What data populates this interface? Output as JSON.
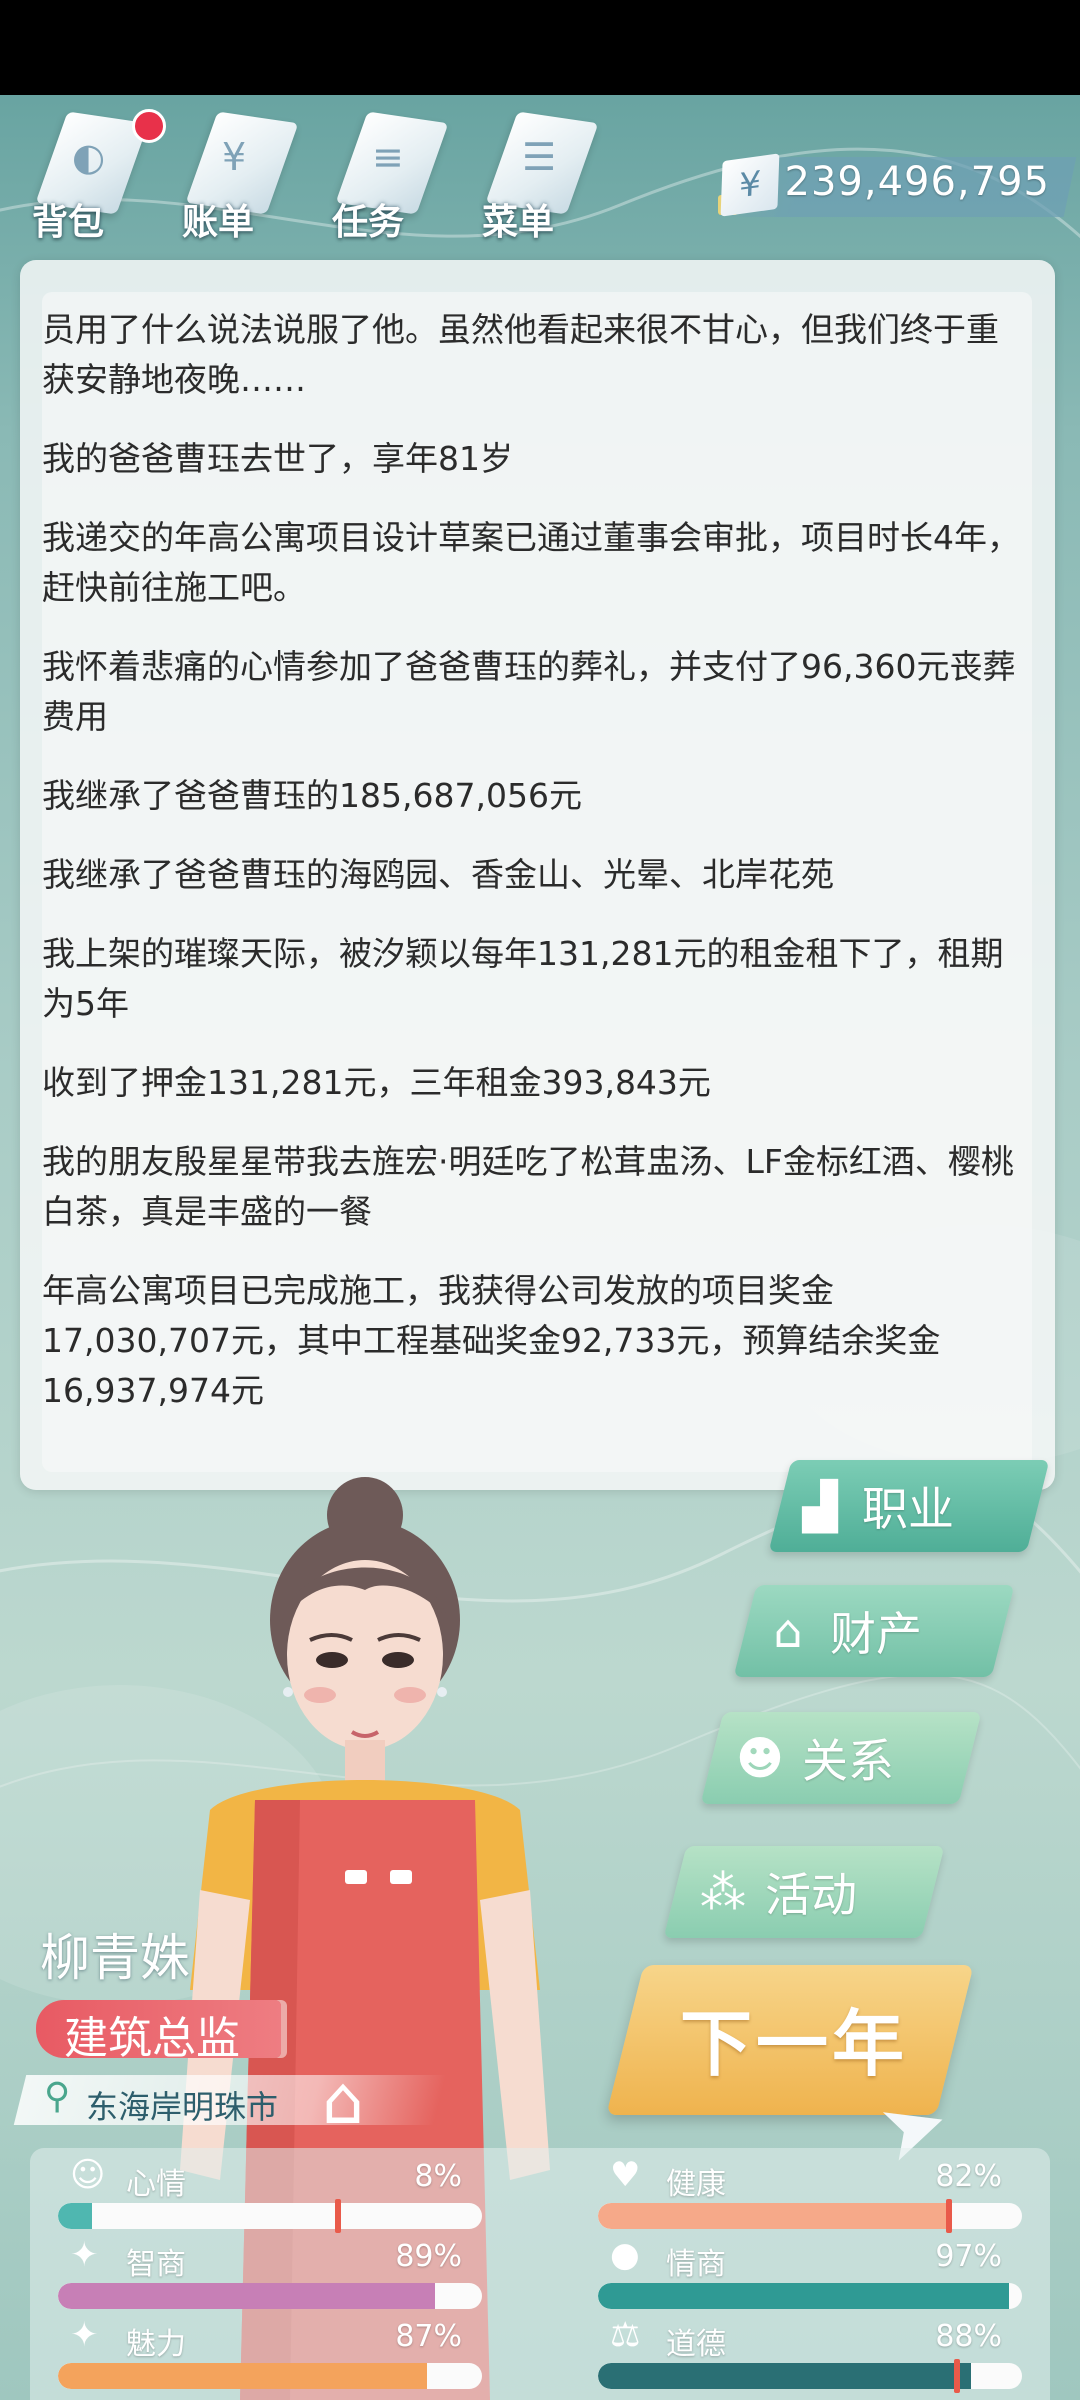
{
  "nav": {
    "items": [
      {
        "label": "背包",
        "icon": "backpack-icon",
        "badge": true
      },
      {
        "label": "账单",
        "icon": "bill-icon"
      },
      {
        "label": "任务",
        "icon": "task-icon"
      },
      {
        "label": "菜单",
        "icon": "menu-icon"
      }
    ],
    "money": {
      "currency_symbol": "¥",
      "value": "239,496,795"
    }
  },
  "log": [
    "员用了什么说法说服了他。虽然他看起来很不甘心，但我们终于重获安静地夜晚……",
    "我的爸爸曹珏去世了，享年81岁",
    "我递交的年高公寓项目设计草案已通过董事会审批，项目时长4年，赶快前往施工吧。",
    "我怀着悲痛的心情参加了爸爸曹珏的葬礼，并支付了96,360元丧葬费用",
    "我继承了爸爸曹珏的185,687,056元",
    "我继承了爸爸曹珏的海鸥园、香金山、光晕、北岸花苑",
    "我上架的璀璨天际，被汐颖以每年131,281元的租金租下了，租期为5年",
    "收到了押金131,281元，三年租金393,843元",
    "我的朋友殷星星带我去旌宏·明廷吃了松茸盅汤、LF金标红酒、樱桃白茶，真是丰盛的一餐",
    "年高公寓项目已完成施工，我获得公司发放的项目奖金17,030,707元，其中工程基础奖金92,733元，预算结余奖金16,937,974元"
  ],
  "actions": {
    "career": {
      "label": "职业",
      "icon": "chart-icon"
    },
    "assets": {
      "label": "财产",
      "icon": "house-icon"
    },
    "relations": {
      "label": "关系",
      "icon": "people-icon"
    },
    "activity": {
      "label": "活动",
      "icon": "dots-icon"
    },
    "next_year": {
      "label": "下一年"
    }
  },
  "character": {
    "name": "柳青姝",
    "job": "建筑总监",
    "city": "东海岸明珠市"
  },
  "stats": {
    "mood": {
      "label": "心情",
      "value": "8%",
      "level": 0.08,
      "color": "#4fb7b0"
    },
    "health": {
      "label": "健康",
      "value": "82%",
      "level": 0.82,
      "color": "#f6a989"
    },
    "iq": {
      "label": "智商",
      "value": "89%",
      "level": 0.89,
      "color": "#c77fb6"
    },
    "eq": {
      "label": "情商",
      "value": "97%",
      "level": 0.97,
      "color": "#2f9a94"
    },
    "charm": {
      "label": "魅力",
      "value": "87%",
      "level": 0.87,
      "color": "#f4a35c"
    },
    "morality": {
      "label": "道德",
      "value": "88%",
      "level": 0.88,
      "color": "#2a6f74"
    }
  }
}
